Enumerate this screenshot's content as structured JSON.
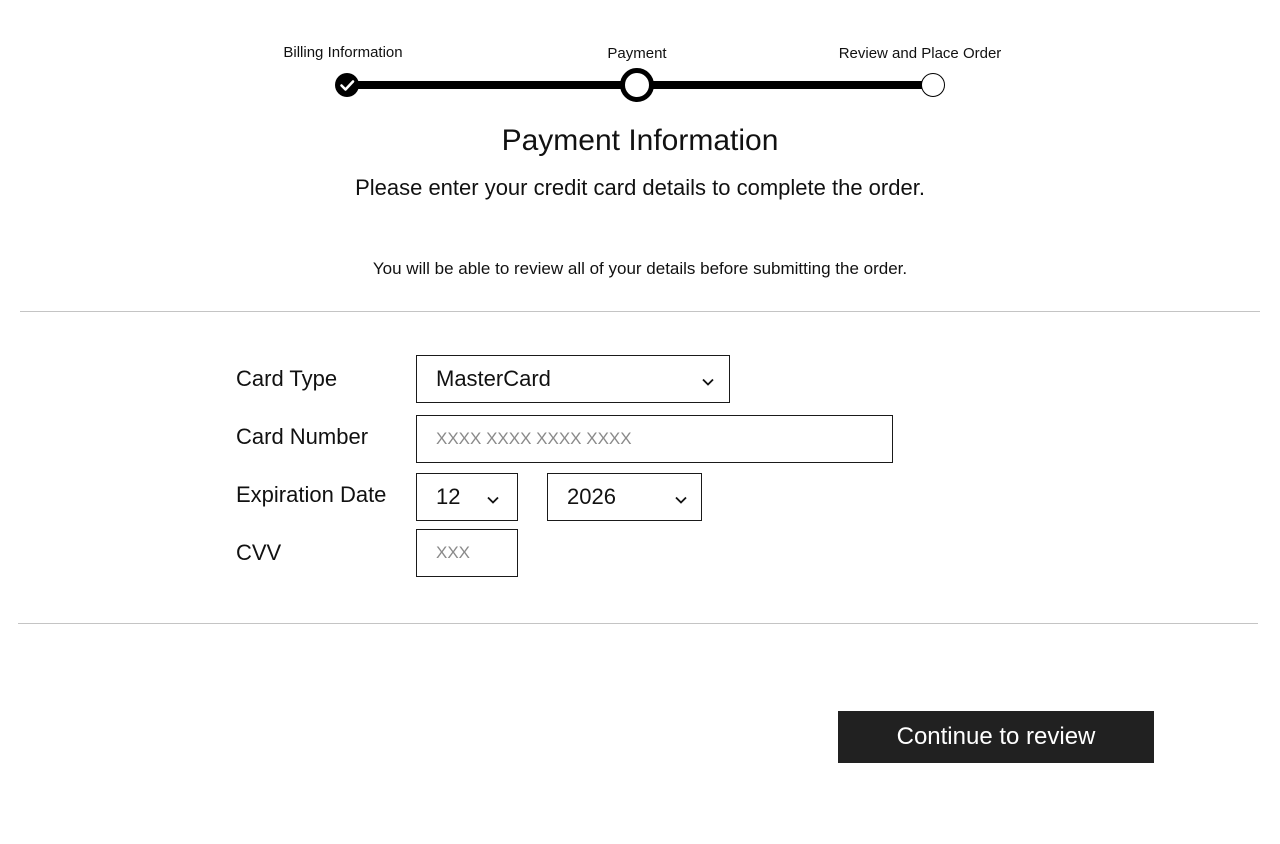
{
  "stepper": {
    "steps": [
      {
        "label": "Billing Information",
        "status": "completed"
      },
      {
        "label": "Payment",
        "status": "current"
      },
      {
        "label": "Review and Place Order",
        "status": "upcoming"
      }
    ]
  },
  "header": {
    "title": "Payment Information",
    "subtitle": "Please enter your credit card details to complete the order.",
    "note": "You will be able to review all of your details before submitting the order."
  },
  "form": {
    "card_type": {
      "label": "Card Type",
      "value": "MasterCard",
      "icon": "chevron-down-icon"
    },
    "card_number": {
      "label": "Card Number",
      "placeholder": "XXXX XXXX XXXX XXXX"
    },
    "expiration": {
      "label": "Expiration Date",
      "month": "12",
      "year": "2026"
    },
    "cvv": {
      "label": "CVV",
      "placeholder": "XXX"
    }
  },
  "actions": {
    "continue_label": "Continue to review"
  },
  "colors": {
    "button_bg": "#212121",
    "button_text": "#ffffff",
    "divider": "#c4c4c4",
    "progress": "#000000"
  }
}
